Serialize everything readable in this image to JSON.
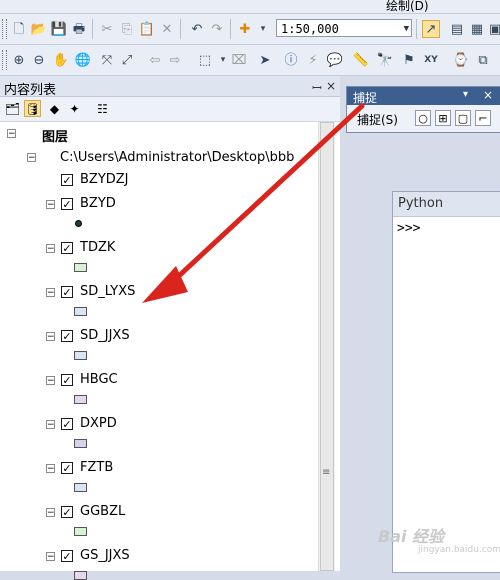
{
  "toolbar": {
    "scale_value": "1:50,000",
    "draw_menu": "绘制(D)"
  },
  "toc": {
    "title": "内容列表",
    "pin": "ꟷ",
    "close": "×",
    "root_label": "图层",
    "path_label": "C:\\Users\\Administrator\\Desktop\\bbb",
    "layers": [
      {
        "name": "BZYDZJ"
      },
      {
        "name": "BZYD"
      },
      {
        "name": "TDZK"
      },
      {
        "name": "SD_LYXS"
      },
      {
        "name": "SD_JJXS"
      },
      {
        "name": "HBGC"
      },
      {
        "name": "DXPD"
      },
      {
        "name": "FZTB"
      },
      {
        "name": "GGBZL"
      },
      {
        "name": "GS_JJXS"
      }
    ]
  },
  "snapping": {
    "title": "捕捉",
    "menu": "捕捉(S)",
    "title_controls": "▾ ×"
  },
  "python": {
    "title": "Python",
    "prompt": ">>>"
  },
  "colors": {
    "arrow": "#d9251d",
    "swatch_green": "#d9f2d6",
    "swatch_blue": "#d6e6f2",
    "swatch_purple": "#e7d6f2",
    "swatch_lavender": "#d5d2ee",
    "point": "#1a3f44"
  },
  "watermark": {
    "text": "Bai 经验",
    "sub": "jingyan.baidu.com"
  }
}
